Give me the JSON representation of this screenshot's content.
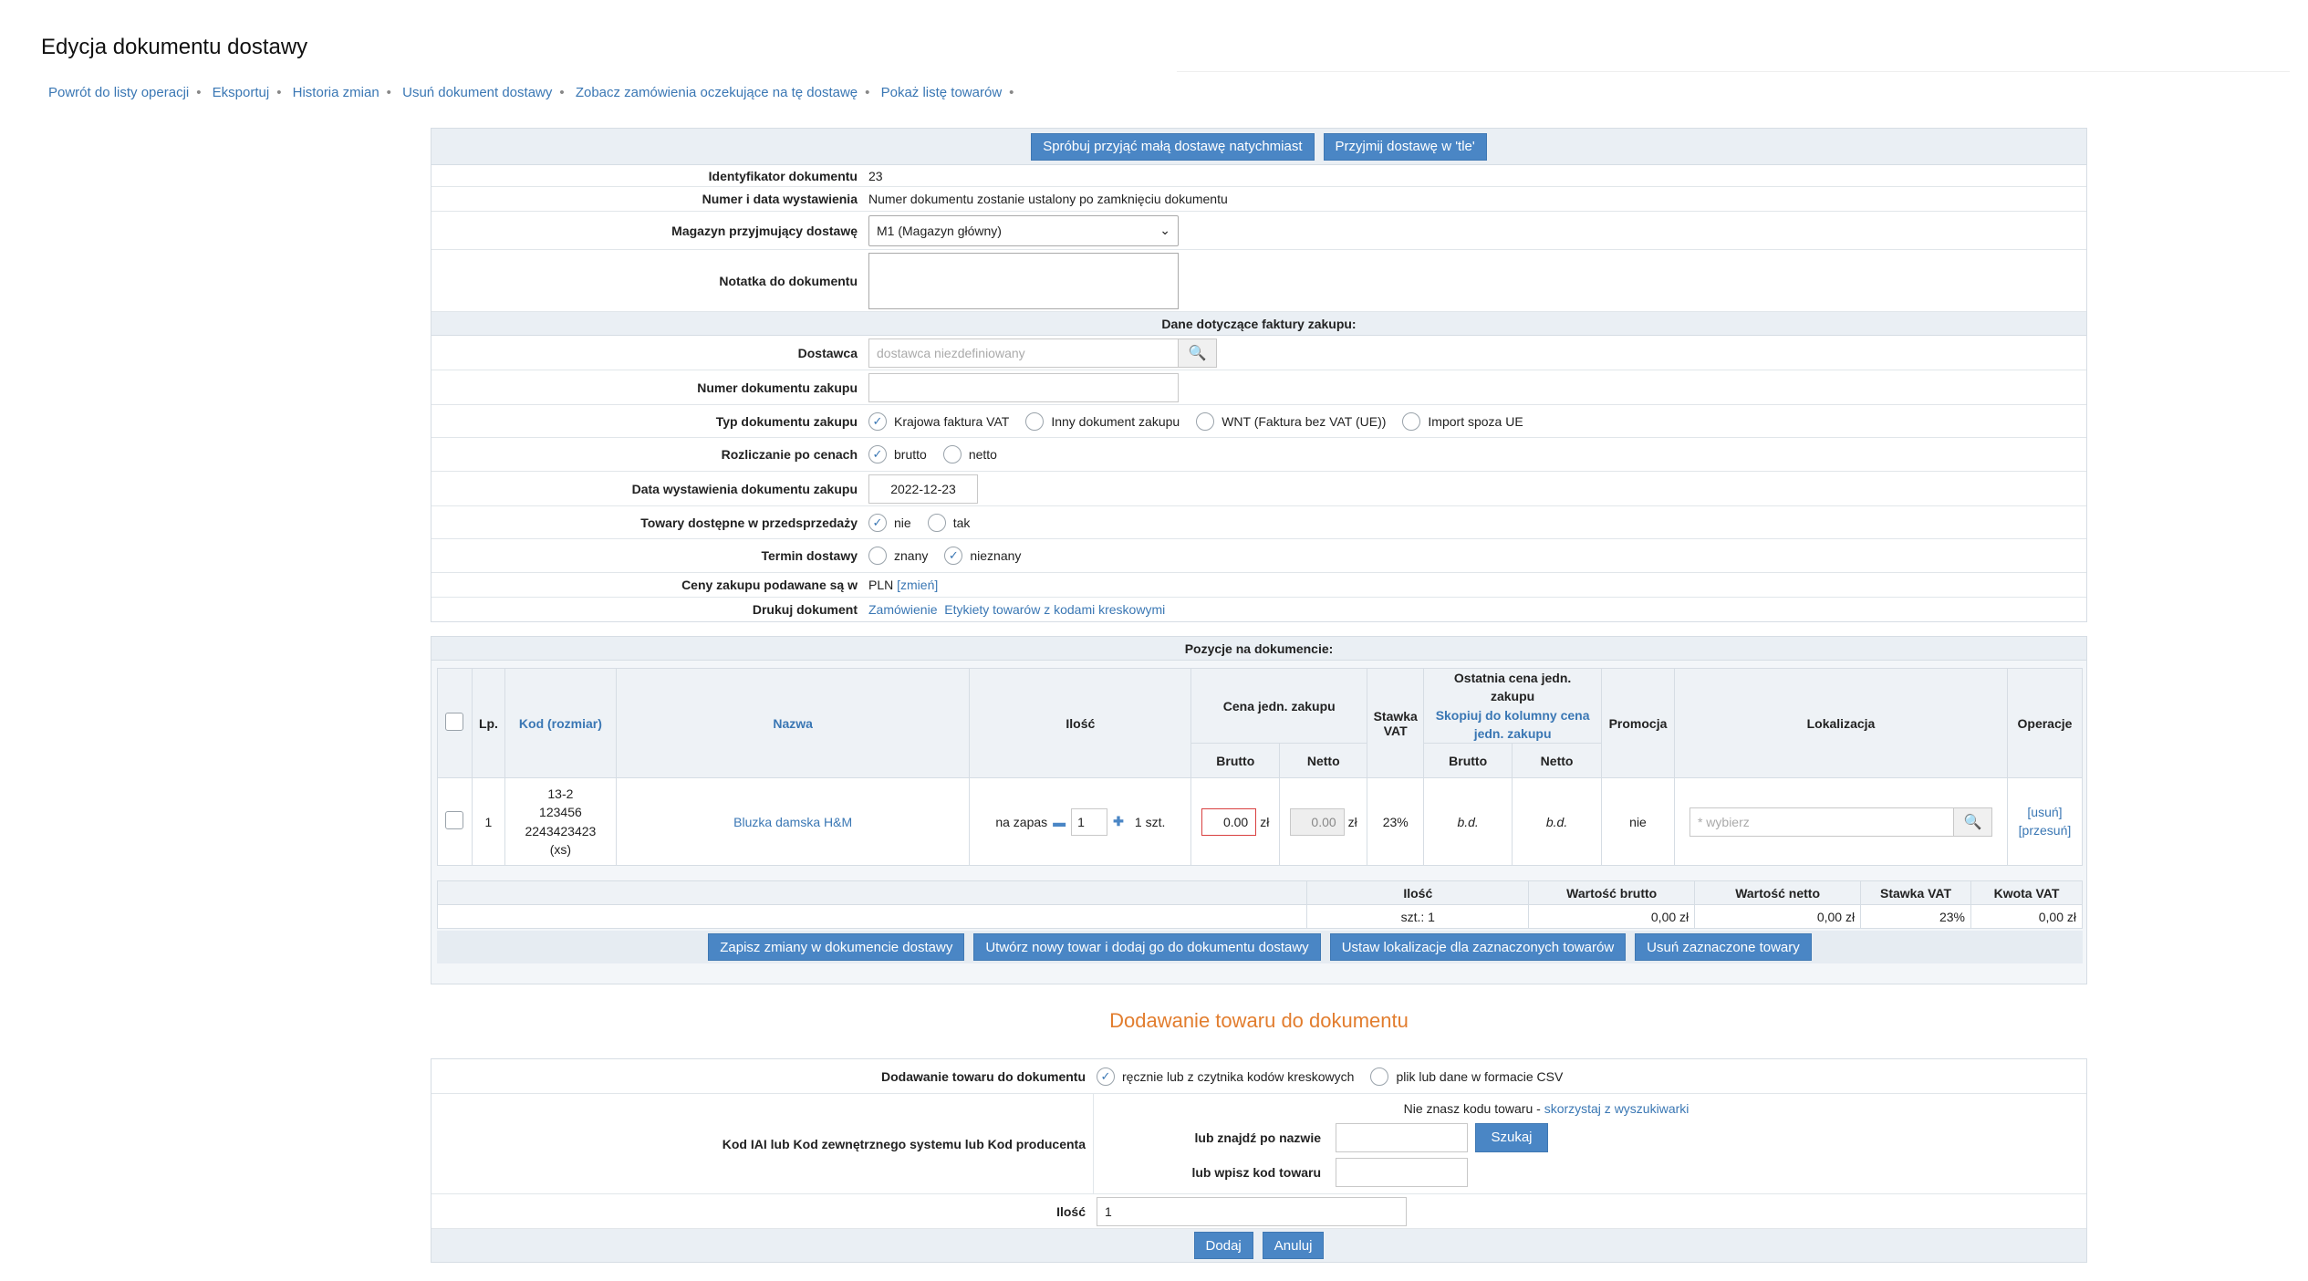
{
  "page": {
    "title": "Edycja dokumentu dostawy"
  },
  "nav": [
    "Powrót do listy operacji",
    "Eksportuj",
    "Historia zmian",
    "Usuń dokument dostawy",
    "Zobacz zamówienia oczekujące na tę dostawę",
    "Pokaż listę towarów"
  ],
  "top_buttons": {
    "try_now": "Spróbuj przyjąć małą dostawę natychmiast",
    "background": "Przyjmij dostawę w 'tle'"
  },
  "doc": {
    "id_label": "Identyfikator dokumentu",
    "id_value": "23",
    "number_label": "Numer i data wystawienia",
    "number_value": "Numer dokumentu zostanie ustalony po zamknięciu dokumentu",
    "warehouse_label": "Magazyn przyjmujący dostawę",
    "warehouse_value": "M1 (Magazyn główny)",
    "note_label": "Notatka do dokumentu",
    "note_value": ""
  },
  "invoice": {
    "band": "Dane dotyczące faktury zakupu:",
    "supplier_label": "Dostawca",
    "supplier_placeholder": "dostawca niezdefiniowany",
    "purchase_no_label": "Numer dokumentu zakupu",
    "purchase_no_value": "",
    "type_label": "Typ dokumentu zakupu",
    "types": [
      {
        "label": "Krajowa faktura VAT",
        "checked": true
      },
      {
        "label": "Inny dokument zakupu",
        "checked": false
      },
      {
        "label": "WNT (Faktura bez VAT (UE))",
        "checked": false
      },
      {
        "label": "Import spoza UE",
        "checked": false
      }
    ],
    "settle_label": "Rozliczanie po cenach",
    "settle": [
      {
        "label": "brutto",
        "checked": true
      },
      {
        "label": "netto",
        "checked": false
      }
    ],
    "date_label": "Data wystawienia dokumentu zakupu",
    "date_value": "2022-12-23",
    "presale_label": "Towary dostępne w przedsprzedaży",
    "presale": [
      {
        "label": "nie",
        "checked": true
      },
      {
        "label": "tak",
        "checked": false
      }
    ],
    "term_label": "Termin dostawy",
    "term": [
      {
        "label": "znany",
        "checked": false
      },
      {
        "label": "nieznany",
        "checked": true
      }
    ],
    "currency_label": "Ceny zakupu podawane są w",
    "currency_value": "PLN",
    "currency_change": "[zmień]",
    "print_label": "Drukuj dokument",
    "print_order": "Zamówienie",
    "print_labels": "Etykiety towarów z kodami kreskowymi"
  },
  "positions": {
    "band": "Pozycje na dokumencie:",
    "headers": {
      "lp": "Lp.",
      "code": "Kod (rozmiar)",
      "name": "Nazwa",
      "qty": "Ilość",
      "price": "Cena jedn. zakupu",
      "vat": "Stawka VAT",
      "last_price_1": "Ostatnia cena jedn.",
      "last_price_2": "zakupu",
      "copy_1": "Skopiuj do kolumny cena",
      "copy_2": "jedn. zakupu",
      "promo": "Promocja",
      "location": "Lokalizacja",
      "ops": "Operacje",
      "gross": "Brutto",
      "net": "Netto",
      "last_gross": "Brutto",
      "last_net": "Netto"
    },
    "rows": [
      {
        "lp": "1",
        "code_1": "13-2",
        "code_2": "123456",
        "code_3": "2243423423",
        "code_4": "(xs)",
        "name": "Bluzka damska H&M",
        "stock_label": "na zapas",
        "qty": "1",
        "unit": "1 szt.",
        "gross": "0.00",
        "currency": "zł",
        "net": "0.00",
        "net_currency": "zł",
        "vat": "23%",
        "last_gross": "b.d.",
        "last_net": "b.d.",
        "promo": "nie",
        "location_placeholder": "* wybierz",
        "op_remove": "[usuń]",
        "op_move": "[przesuń]"
      }
    ]
  },
  "summary": {
    "headers": [
      "Ilość",
      "Wartość brutto",
      "Wartość netto",
      "Stawka VAT",
      "Kwota VAT"
    ],
    "values": [
      "szt.: 1",
      "0,00 zł",
      "0,00 zł",
      "23%",
      "0,00 zł"
    ]
  },
  "bottom_buttons": {
    "save": "Zapisz zmiany w dokumencie dostawy",
    "create": "Utwórz nowy towar i dodaj go do dokumentu dostawy",
    "set_location": "Ustaw lokalizacje dla zaznaczonych towarów",
    "remove_selected": "Usuń zaznaczone towary"
  },
  "add": {
    "title": "Dodawanie towaru do dokumentu",
    "mode_label": "Dodawanie towaru do dokumentu",
    "modes": [
      {
        "label": "ręcznie lub z czytnika kodów kreskowych",
        "checked": true
      },
      {
        "label": "plik lub dane w formacie CSV",
        "checked": false
      }
    ],
    "code_label": "Kod IAI lub Kod zewnętrznego systemu lub Kod producenta",
    "hint_prefix": "Nie znasz kodu towaru - ",
    "hint_link": "skorzystaj z wyszukiwarki",
    "find_label": "lub znajdź po nazwie",
    "find_value": "",
    "find_button": "Szukaj",
    "enter_label": "lub wpisz kod towaru",
    "enter_value": "",
    "qty_label": "Ilość",
    "qty_value": "1",
    "add_button": "Dodaj",
    "cancel_button": "Anuluj"
  }
}
